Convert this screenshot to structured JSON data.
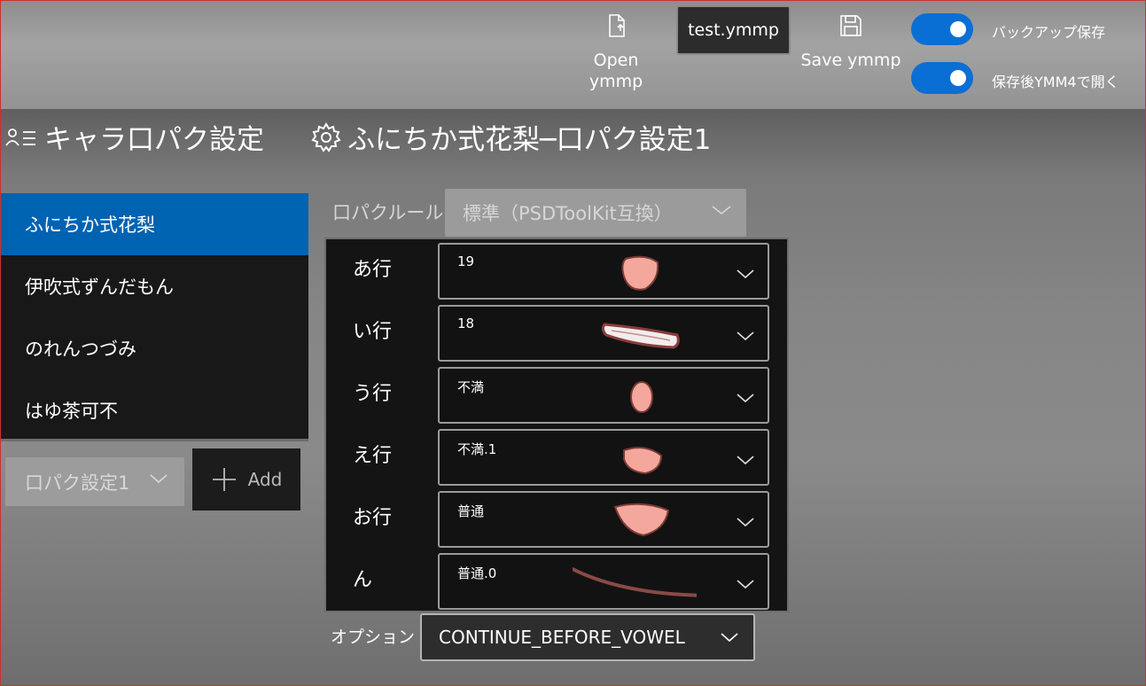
{
  "toolbar": {
    "open_label_1": "Open",
    "open_label_2": "ymmp",
    "file_name": "test.ymmp",
    "save_label": "Save ymmp",
    "backup_label": "バックアップ保存",
    "backup_on": true,
    "open_after_save_label": "保存後YMM4で開く",
    "open_after_save_on": true,
    "accent_color": "#0a6fd4"
  },
  "left_header": {
    "title": "キャラ口パク設定",
    "icon": "character-list-icon"
  },
  "right_header": {
    "title": "ふにちか式花梨─口パク設定1",
    "icon": "gear-icon"
  },
  "characters": [
    {
      "name": "ふにちか式花梨",
      "selected": true
    },
    {
      "name": "伊吹式ずんだもん",
      "selected": false
    },
    {
      "name": "のれんつづみ",
      "selected": false
    },
    {
      "name": "はゆ茶可不",
      "selected": false
    }
  ],
  "preset": {
    "value": "口パク設定1"
  },
  "add_button": {
    "label": "Add"
  },
  "rule": {
    "label": "口パクルール",
    "value": "標準（PSDToolKit互換）"
  },
  "vowels": [
    {
      "label": "あ行",
      "value": "19",
      "mouth": "open-round"
    },
    {
      "label": "い行",
      "value": "18",
      "mouth": "wide-flat"
    },
    {
      "label": "う行",
      "value": "不満",
      "mouth": "small-oval"
    },
    {
      "label": "え行",
      "value": "不満.1",
      "mouth": "half-open"
    },
    {
      "label": "お行",
      "value": "普通",
      "mouth": "half-moon"
    },
    {
      "label": "ん",
      "value": "普通.0",
      "mouth": "closed-line"
    }
  ],
  "option": {
    "label": "オプション",
    "value": "CONTINUE_BEFORE_VOWEL"
  }
}
